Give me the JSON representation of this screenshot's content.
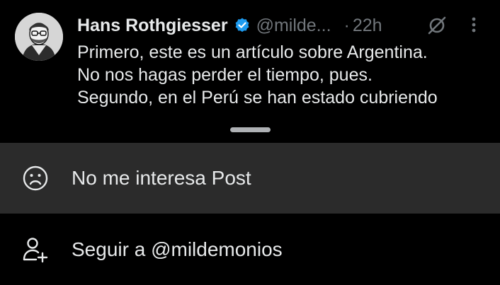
{
  "post": {
    "author_name": "Hans Rothgiesser",
    "author_handle": "@milde...",
    "dot": "·",
    "timestamp": "22h",
    "lines": [
      "Primero, este es un artículo sobre Argentina.",
      "No nos hagas perder el tiempo, pues.",
      "Segundo, en el Perú se han estado cubriendo"
    ],
    "icons": {
      "verified": "verified-badge-icon",
      "grok": "grok-icon",
      "more": "more-vertical-icon"
    },
    "colors": {
      "verified": "#1d9bf0",
      "secondary_text": "#71767b"
    }
  },
  "menu": {
    "items": [
      {
        "label": "No me interesa Post",
        "icon": "frown-face-icon",
        "active": true
      },
      {
        "label": "Seguir a @mildemonios",
        "icon": "add-user-icon",
        "active": false
      }
    ],
    "colors": {
      "active_background": "#2b2b2b",
      "background": "#000000"
    }
  }
}
